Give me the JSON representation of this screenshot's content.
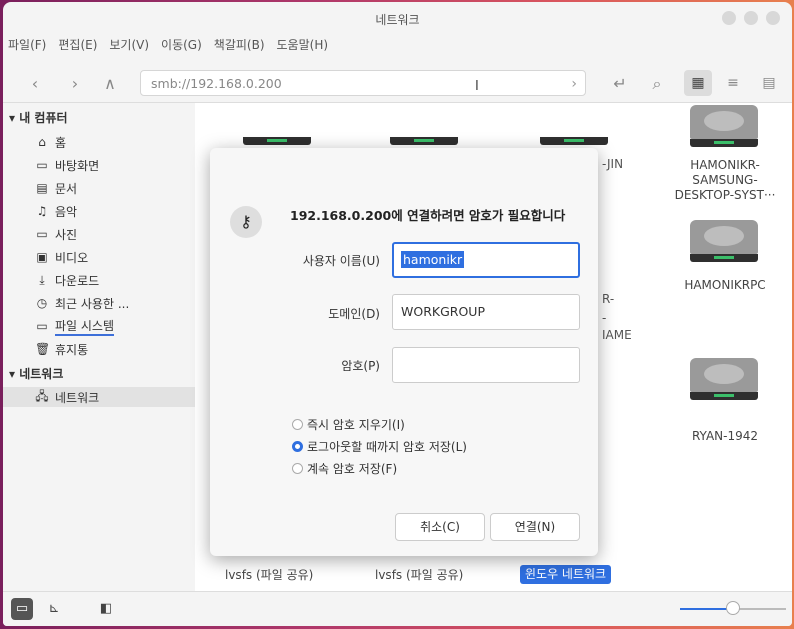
{
  "window": {
    "title": "네트워크"
  },
  "menu": [
    "파일(F)",
    "편집(E)",
    "보기(V)",
    "이동(G)",
    "책갈피(B)",
    "도움말(H)"
  ],
  "toolbar": {
    "back_icon": "chevron-left-icon",
    "forward_icon": "chevron-right-icon",
    "up_icon": "chevron-up-icon",
    "path": "smb://192.168.0.200",
    "path_arrow_icon": "chevron-right-icon",
    "action_icons": [
      "return-icon",
      "search-icon",
      "grid-view-icon",
      "list-view-icon",
      "compact-view-icon"
    ]
  },
  "sidebar": {
    "my_computer": "내 컴퓨터",
    "items": [
      {
        "label": "홈",
        "icon": "home-icon"
      },
      {
        "label": "바탕화면",
        "icon": "desktop-icon"
      },
      {
        "label": "문서",
        "icon": "document-icon"
      },
      {
        "label": "음악",
        "icon": "music-icon"
      },
      {
        "label": "사진",
        "icon": "picture-icon"
      },
      {
        "label": "비디오",
        "icon": "video-icon"
      },
      {
        "label": "다운로드",
        "icon": "download-icon"
      },
      {
        "label": "최근 사용한 ...",
        "icon": "recent-icon"
      },
      {
        "label": "파일 시스템",
        "icon": "drive-icon"
      },
      {
        "label": "휴지통",
        "icon": "trash-icon"
      }
    ],
    "network": "네트워크",
    "network_items": [
      {
        "label": "네트워크",
        "icon": "network-icon"
      }
    ]
  },
  "content": {
    "items": [
      {
        "label": "HAMONIKR-\nSAMSUNG-\nDESKTOP-SYST···"
      },
      {
        "label": "HAMONIKRPC"
      },
      {
        "label": "RYAN-1942"
      },
      {
        "label": "lvsfs (파일 공유)"
      },
      {
        "label": "lvsfs (파일 공유)"
      },
      {
        "label": "윈도우 네트워크"
      }
    ],
    "partial_texts": [
      "-JIN",
      "R-",
      "-",
      "IAME"
    ]
  },
  "dialog": {
    "message": "192.168.0.200에 연결하려면 암호가 필요합니다",
    "icon": "lock-icon",
    "username_label": "사용자 이름(U)",
    "username_value": "hamonikr",
    "domain_label": "도메인(D)",
    "domain_value": "WORKGROUP",
    "password_label": "암호(P)",
    "password_value": "",
    "radios": [
      {
        "label": "즉시 암호 지우기(I)",
        "checked": false
      },
      {
        "label": "로그아웃할 때까지 암호 저장(L)",
        "checked": true
      },
      {
        "label": "계속 암호 저장(F)",
        "checked": false
      }
    ],
    "cancel": "취소(C)",
    "connect": "연결(N)"
  },
  "statusbar": {
    "icons": [
      "places-icon",
      "tree-icon",
      "toggle-sidebar-icon"
    ],
    "zoom_level": 0.5
  },
  "colors": {
    "accent": "#2f6fe0"
  }
}
